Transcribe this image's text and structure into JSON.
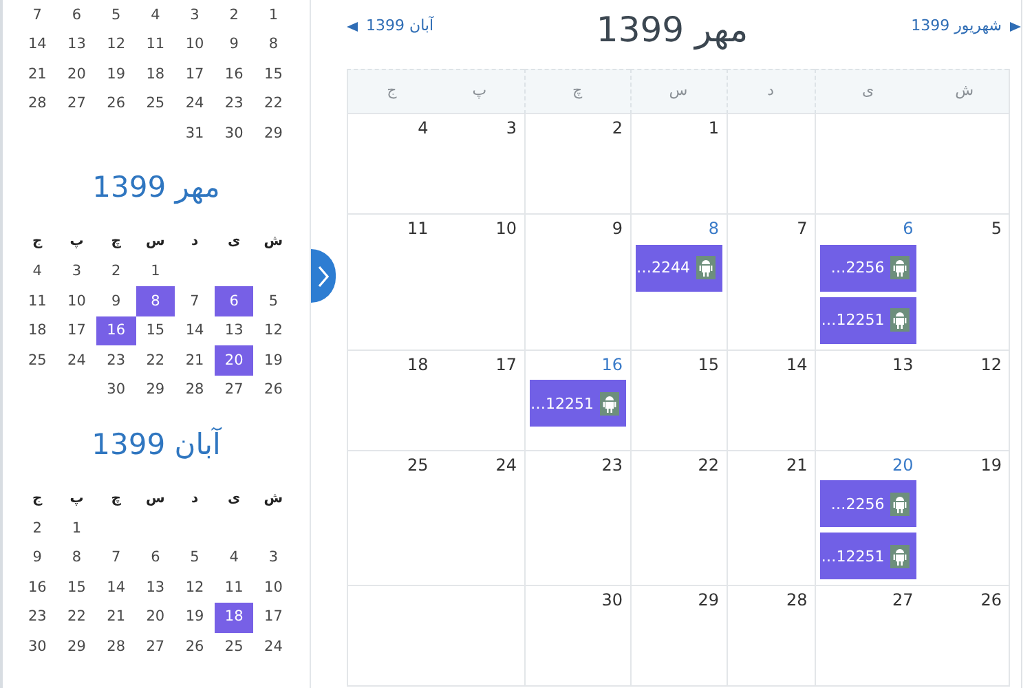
{
  "sidebar": {
    "months": [
      {
        "weeks": [
          {
            "kind": "full",
            "days": [
              {
                "label": "1",
                "selected": false
              },
              {
                "label": "2",
                "selected": false
              },
              {
                "label": "3",
                "selected": false
              },
              {
                "label": "4",
                "selected": false
              },
              {
                "label": "5",
                "selected": false
              },
              {
                "label": "6",
                "selected": false
              },
              {
                "label": "7",
                "selected": false
              }
            ]
          },
          {
            "kind": "full",
            "days": [
              {
                "label": "8",
                "selected": false
              },
              {
                "label": "9",
                "selected": false
              },
              {
                "label": "10",
                "selected": false
              },
              {
                "label": "11",
                "selected": false
              },
              {
                "label": "12",
                "selected": false
              },
              {
                "label": "13",
                "selected": false
              },
              {
                "label": "14",
                "selected": false
              }
            ]
          },
          {
            "kind": "full",
            "days": [
              {
                "label": "15",
                "selected": false
              },
              {
                "label": "16",
                "selected": false
              },
              {
                "label": "17",
                "selected": false
              },
              {
                "label": "18",
                "selected": false
              },
              {
                "label": "19",
                "selected": false
              },
              {
                "label": "20",
                "selected": false
              },
              {
                "label": "21",
                "selected": false
              }
            ]
          },
          {
            "kind": "full",
            "days": [
              {
                "label": "22",
                "selected": false
              },
              {
                "label": "23",
                "selected": false
              },
              {
                "label": "24",
                "selected": false
              },
              {
                "label": "25",
                "selected": false
              },
              {
                "label": "26",
                "selected": false
              },
              {
                "label": "27",
                "selected": false
              },
              {
                "label": "28",
                "selected": false
              }
            ]
          },
          {
            "kind": "last",
            "days": [
              {
                "label": "29",
                "selected": false
              },
              {
                "label": "30",
                "selected": false
              },
              {
                "label": "31",
                "selected": false
              }
            ]
          }
        ]
      },
      {
        "title": "مهر 1399",
        "weekdays": [
          "ش",
          "ی",
          "د",
          "س",
          "چ",
          "پ",
          "ج"
        ],
        "weeks": [
          {
            "kind": "first",
            "days": [
              {
                "label": "1",
                "selected": false
              },
              {
                "label": "2",
                "selected": false
              },
              {
                "label": "3",
                "selected": false
              },
              {
                "label": "4",
                "selected": false
              }
            ]
          },
          {
            "kind": "full",
            "days": [
              {
                "label": "5",
                "selected": false
              },
              {
                "label": "6",
                "selected": true
              },
              {
                "label": "7",
                "selected": false
              },
              {
                "label": "8",
                "selected": true
              },
              {
                "label": "9",
                "selected": false
              },
              {
                "label": "10",
                "selected": false
              },
              {
                "label": "11",
                "selected": false
              }
            ]
          },
          {
            "kind": "full",
            "days": [
              {
                "label": "12",
                "selected": false
              },
              {
                "label": "13",
                "selected": false
              },
              {
                "label": "14",
                "selected": false
              },
              {
                "label": "15",
                "selected": false
              },
              {
                "label": "16",
                "selected": true
              },
              {
                "label": "17",
                "selected": false
              },
              {
                "label": "18",
                "selected": false
              }
            ]
          },
          {
            "kind": "full",
            "days": [
              {
                "label": "19",
                "selected": false
              },
              {
                "label": "20",
                "selected": true
              },
              {
                "label": "21",
                "selected": false
              },
              {
                "label": "22",
                "selected": false
              },
              {
                "label": "23",
                "selected": false
              },
              {
                "label": "24",
                "selected": false
              },
              {
                "label": "25",
                "selected": false
              }
            ]
          },
          {
            "kind": "last",
            "days": [
              {
                "label": "26",
                "selected": false
              },
              {
                "label": "27",
                "selected": false
              },
              {
                "label": "28",
                "selected": false
              },
              {
                "label": "29",
                "selected": false
              },
              {
                "label": "30",
                "selected": false
              }
            ]
          }
        ]
      },
      {
        "title": "آبان 1399",
        "weekdays": [
          "ش",
          "ی",
          "د",
          "س",
          "چ",
          "پ",
          "ج"
        ],
        "weeks": [
          {
            "kind": "first",
            "days": [
              {
                "label": "1",
                "selected": false
              },
              {
                "label": "2",
                "selected": false
              }
            ]
          },
          {
            "kind": "full",
            "days": [
              {
                "label": "3",
                "selected": false
              },
              {
                "label": "4",
                "selected": false
              },
              {
                "label": "5",
                "selected": false
              },
              {
                "label": "6",
                "selected": false
              },
              {
                "label": "7",
                "selected": false
              },
              {
                "label": "8",
                "selected": false
              },
              {
                "label": "9",
                "selected": false
              }
            ]
          },
          {
            "kind": "full",
            "days": [
              {
                "label": "10",
                "selected": false
              },
              {
                "label": "11",
                "selected": false
              },
              {
                "label": "12",
                "selected": false
              },
              {
                "label": "13",
                "selected": false
              },
              {
                "label": "14",
                "selected": false
              },
              {
                "label": "15",
                "selected": false
              },
              {
                "label": "16",
                "selected": false
              }
            ]
          },
          {
            "kind": "full",
            "days": [
              {
                "label": "17",
                "selected": false
              },
              {
                "label": "18",
                "selected": true
              },
              {
                "label": "19",
                "selected": false
              },
              {
                "label": "20",
                "selected": false
              },
              {
                "label": "21",
                "selected": false
              },
              {
                "label": "22",
                "selected": false
              },
              {
                "label": "23",
                "selected": false
              }
            ]
          },
          {
            "kind": "full",
            "days": [
              {
                "label": "24",
                "selected": false
              },
              {
                "label": "25",
                "selected": false
              },
              {
                "label": "26",
                "selected": false
              },
              {
                "label": "27",
                "selected": false
              },
              {
                "label": "28",
                "selected": false
              },
              {
                "label": "29",
                "selected": false
              },
              {
                "label": "30",
                "selected": false
              }
            ]
          }
        ]
      }
    ]
  },
  "calendar": {
    "prev": {
      "label": "شهریور 1399"
    },
    "title": "مهر 1399",
    "next": {
      "label": "آبان 1399"
    },
    "weekdays": [
      "ش",
      "ی",
      "د",
      "س",
      "چ",
      "پ",
      "ج"
    ],
    "weeks": [
      {
        "kind": "first",
        "days": [
          {
            "label": "1",
            "highlighted": false
          },
          {
            "label": "2",
            "highlighted": false
          },
          {
            "label": "3",
            "highlighted": false
          },
          {
            "label": "4",
            "highlighted": false
          }
        ]
      },
      {
        "kind": "full",
        "days": [
          {
            "label": "5",
            "highlighted": false
          },
          {
            "label": "6",
            "highlighted": true,
            "events": [
              {
                "label": "…2256"
              },
              {
                "label": "…12251"
              }
            ]
          },
          {
            "label": "7",
            "highlighted": false
          },
          {
            "label": "8",
            "highlighted": true,
            "events": [
              {
                "label": "…2244"
              }
            ]
          },
          {
            "label": "9",
            "highlighted": false
          },
          {
            "label": "10",
            "highlighted": false
          },
          {
            "label": "11",
            "highlighted": false
          }
        ]
      },
      {
        "kind": "full",
        "days": [
          {
            "label": "12",
            "highlighted": false
          },
          {
            "label": "13",
            "highlighted": false
          },
          {
            "label": "14",
            "highlighted": false
          },
          {
            "label": "15",
            "highlighted": false
          },
          {
            "label": "16",
            "highlighted": true,
            "events": [
              {
                "label": "…12251"
              }
            ]
          },
          {
            "label": "17",
            "highlighted": false
          },
          {
            "label": "18",
            "highlighted": false
          }
        ]
      },
      {
        "kind": "full",
        "days": [
          {
            "label": "19",
            "highlighted": false
          },
          {
            "label": "20",
            "highlighted": true,
            "events": [
              {
                "label": "…2256"
              },
              {
                "label": "…12251"
              }
            ]
          },
          {
            "label": "21",
            "highlighted": false
          },
          {
            "label": "22",
            "highlighted": false
          },
          {
            "label": "23",
            "highlighted": false
          },
          {
            "label": "24",
            "highlighted": false
          },
          {
            "label": "25",
            "highlighted": false
          }
        ]
      },
      {
        "kind": "last",
        "days": [
          {
            "label": "26",
            "highlighted": false
          },
          {
            "label": "27",
            "highlighted": false
          },
          {
            "label": "28",
            "highlighted": false
          },
          {
            "label": "29",
            "highlighted": false
          },
          {
            "label": "30",
            "highlighted": false
          }
        ]
      }
    ]
  }
}
